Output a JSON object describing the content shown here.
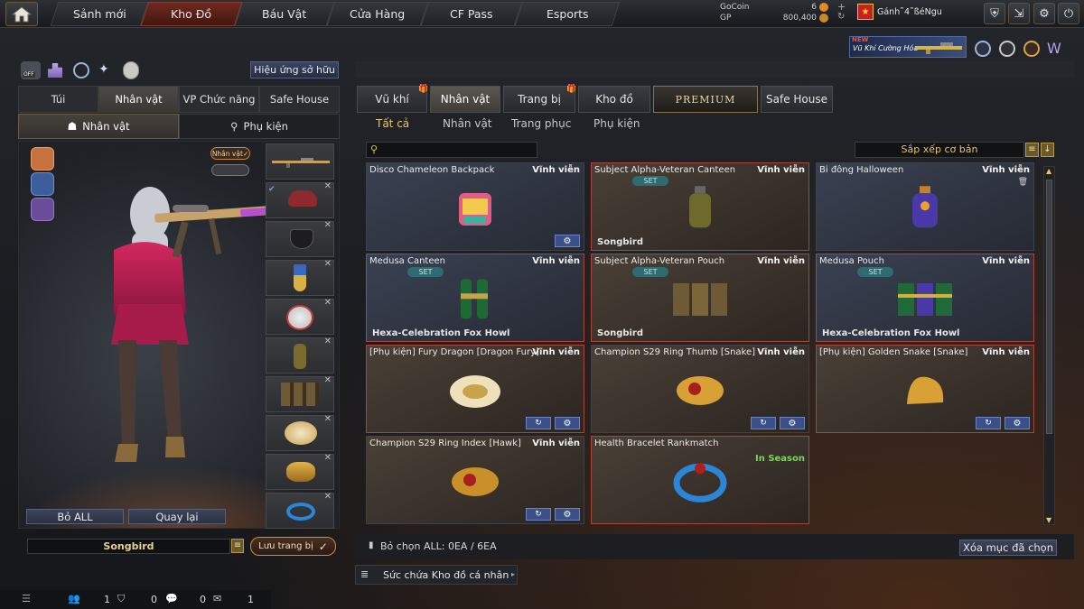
{
  "nav": {
    "tabs": [
      "Sảnh mới",
      "Kho Đồ",
      "Báu Vật",
      "Cửa Hàng",
      "CF Pass",
      "Esports"
    ],
    "active": 1
  },
  "currency": {
    "gocoin_label": "GoCoin",
    "gocoin_value": "6",
    "gp_label": "GP",
    "gp_value": "800,400"
  },
  "user": {
    "name": "Gánh˜4˜ßéNgu"
  },
  "banner": {
    "new": "NEW",
    "text": "Vũ Khí Cường Hóa"
  },
  "left": {
    "effects_button": "Hiệu ứng sở hữu",
    "off_badge": "OFF",
    "tabs": [
      "Túi",
      "Nhân vật",
      "VP Chức năng",
      "Safe House"
    ],
    "active_tab": 1,
    "subtabs": [
      "Nhân vật",
      "Phụ kiện"
    ],
    "char_badge": "Nhân vật",
    "buttons": {
      "unequip_all": "Bỏ ALL",
      "back": "Quay lại"
    },
    "set_name": "Songbird",
    "save_button": "Lưu trang bị"
  },
  "right": {
    "tabs": [
      "Vũ khí",
      "Nhân vật",
      "Trang bị",
      "Kho đồ",
      "PREMIUM",
      "Safe House"
    ],
    "active_tab": 1,
    "subtabs": [
      "Tất cả",
      "Nhân vật",
      "Trang phục",
      "Phụ kiện"
    ],
    "active_sub": 0,
    "search_placeholder": "",
    "sort_label": "Sắp xếp cơ bản",
    "items": [
      {
        "name": "Disco Chameleon Backpack",
        "duration": "Vĩnh viễn",
        "set": "",
        "foot": "",
        "color": "blue",
        "red": false,
        "icons": 1
      },
      {
        "name": "Subject Alpha-Veteran Canteen",
        "duration": "Vĩnh viễn",
        "set": "SET",
        "foot": "Songbird",
        "color": "brown",
        "red": true,
        "icons": 0
      },
      {
        "name": "Bi đông Halloween",
        "duration": "Vĩnh viễn",
        "set": "",
        "foot": "",
        "color": "blue",
        "red": false,
        "icons": 0
      },
      {
        "name": "Medusa Canteen",
        "duration": "Vĩnh viễn",
        "set": "SET",
        "foot": "Hexa-Celebration Fox Howl",
        "color": "blue",
        "red": true,
        "icons": 0
      },
      {
        "name": "Subject Alpha-Veteran Pouch",
        "duration": "Vĩnh viễn",
        "set": "SET",
        "foot": "Songbird",
        "color": "brown",
        "red": true,
        "icons": 0
      },
      {
        "name": "Medusa Pouch",
        "duration": "Vĩnh viễn",
        "set": "SET",
        "foot": "Hexa-Celebration Fox Howl",
        "color": "blue",
        "red": true,
        "icons": 0
      },
      {
        "name": "[Phụ kiện] Fury Dragon [Dragon Fury]",
        "duration": "Vĩnh viễn",
        "set": "",
        "foot": "",
        "color": "brown",
        "red": true,
        "icons": 2
      },
      {
        "name": "Champion S29 Ring Thumb [Snake]",
        "duration": "Vĩnh viễn",
        "set": "",
        "foot": "",
        "color": "brown",
        "red": false,
        "icons": 2
      },
      {
        "name": "[Phụ kiện] Golden Snake [Snake]",
        "duration": "Vĩnh viễn",
        "set": "",
        "foot": "",
        "color": "brown",
        "red": true,
        "icons": 2
      },
      {
        "name": "Champion S29 Ring Index [Hawk]",
        "duration": "Vĩnh viễn",
        "set": "",
        "foot": "",
        "color": "brown",
        "red": false,
        "icons": 2
      },
      {
        "name": "Health Bracelet Rankmatch",
        "duration": "In Season",
        "set": "",
        "foot": "",
        "color": "brown",
        "red": true,
        "icons": 0
      }
    ],
    "deselect_text": "Bỏ chọn ALL: 0EA / 6EA",
    "delete_button": "Xóa mục đã chọn",
    "capacity_button": "Sức chứa Kho đồ cá nhân"
  },
  "statusbar": {
    "c1": "1",
    "c2": "0",
    "c3": "0",
    "c4": "1"
  }
}
